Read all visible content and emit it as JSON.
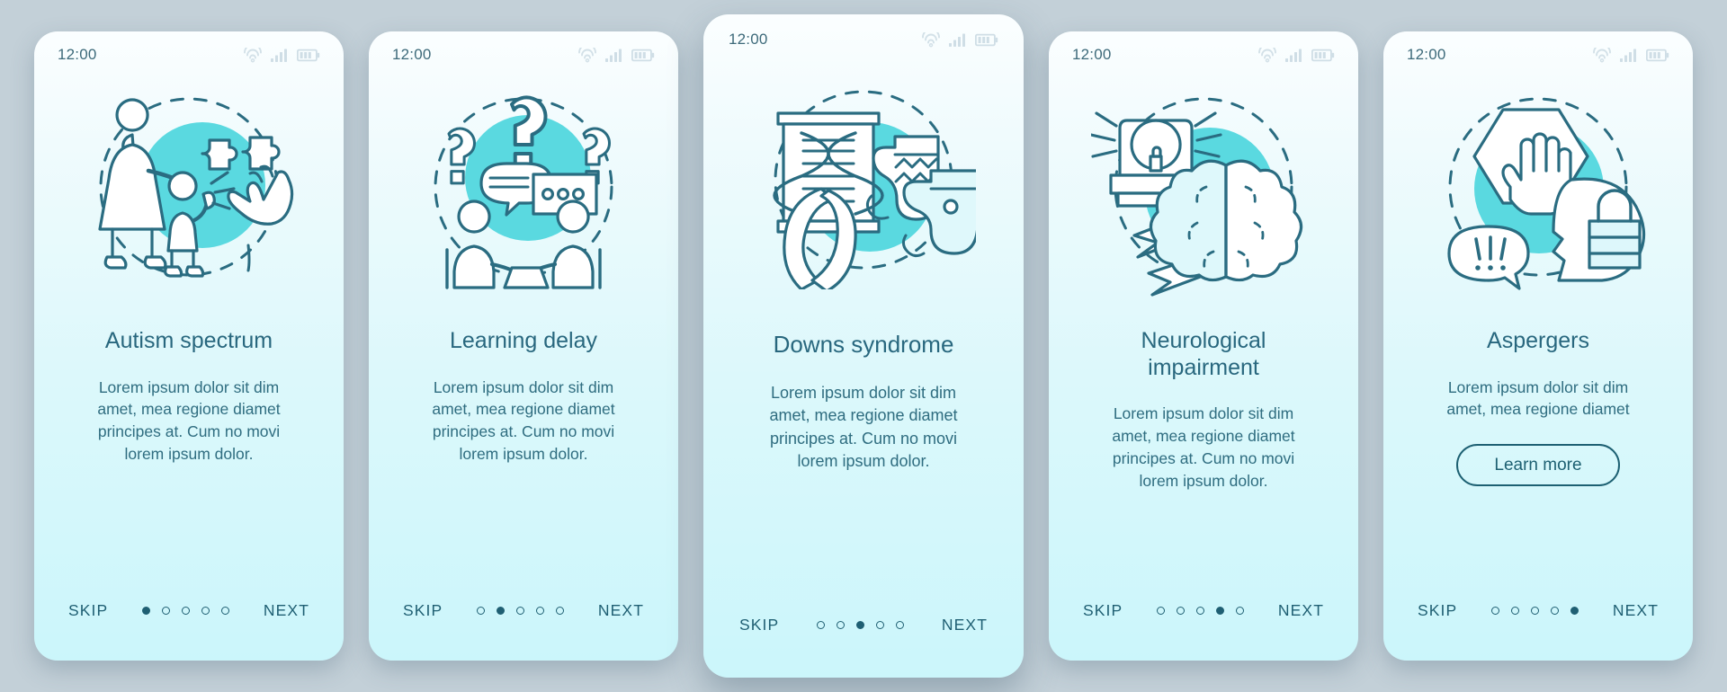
{
  "theme": {
    "page_bg": "#c3d0d8",
    "accent": "#5ad9e0",
    "ink": "#2a6c81",
    "line": "#1d6072",
    "card_top": "#fbfeff",
    "card_bottom": "#cbf6fb"
  },
  "status_bar": {
    "time": "12:00",
    "icons": [
      "wifi-icon",
      "cellular-signal-icon",
      "battery-icon"
    ]
  },
  "nav": {
    "skip_label": "SKIP",
    "next_label": "NEXT",
    "dot_count": 5
  },
  "screens": [
    {
      "id": "autism-spectrum",
      "illustration": "mother-child-puzzle-clapping-hands-icon",
      "title": "Autism spectrum",
      "description": "Lorem ipsum dolor sit dim\namet, mea regione diamet\nprincipes at. Cum no movi\nlorem ipsum dolor.",
      "active_dot": 1,
      "cta_label": null,
      "featured": false
    },
    {
      "id": "learning-delay",
      "illustration": "question-marks-speech-bubbles-people-icon",
      "title": "Learning delay",
      "description": "Lorem ipsum dolor sit dim\namet, mea regione diamet\nprincipes at. Cum no movi\nlorem ipsum dolor.",
      "active_dot": 2,
      "cta_label": null,
      "featured": false
    },
    {
      "id": "downs-syndrome",
      "illustration": "dna-helix-socks-ribbon-icon",
      "title": "Downs syndrome",
      "description": "Lorem ipsum dolor sit dim\namet, mea regione diamet\nprincipes at. Cum no movi\nlorem ipsum dolor.",
      "active_dot": 3,
      "cta_label": null,
      "featured": true
    },
    {
      "id": "neurological-impairment",
      "illustration": "siren-lightning-brain-icon",
      "title": "Neurological\nimpairment",
      "description": "Lorem ipsum dolor sit dim\namet, mea regione diamet\nprincipes at. Cum no movi\nlorem ipsum dolor.",
      "active_dot": 4,
      "cta_label": null,
      "featured": false
    },
    {
      "id": "aspergers",
      "illustration": "stop-hand-bubble-head-lock-icon",
      "title": "Aspergers",
      "description": "Lorem ipsum dolor sit dim\namet, mea regione diamet",
      "active_dot": 5,
      "cta_label": "Learn more",
      "featured": false
    }
  ]
}
